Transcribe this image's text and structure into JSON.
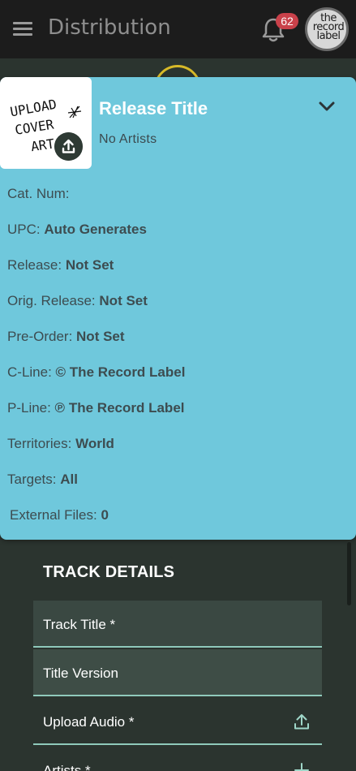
{
  "appbar": {
    "title": "Distribution",
    "notification_count": "62",
    "avatar_text": [
      "the",
      "record",
      "label"
    ]
  },
  "release": {
    "cover_text": [
      "UPLOAD",
      "COVER",
      "ART"
    ],
    "title": "Release Title",
    "artists": "No Artists",
    "details": [
      {
        "label": "Cat. Num:",
        "value": ""
      },
      {
        "label": "UPC:",
        "value": "Auto Generates"
      },
      {
        "label": "Release:",
        "value": "Not Set"
      },
      {
        "label": "Orig. Release:",
        "value": "Not Set"
      },
      {
        "label": "Pre-Order:",
        "value": "Not Set"
      },
      {
        "label": "C-Line:",
        "value": "© The Record Label"
      },
      {
        "label": "P-Line:",
        "value": "℗ The Record Label"
      },
      {
        "label": "Territories:",
        "value": "World"
      },
      {
        "label": "Targets:",
        "value": "All"
      },
      {
        "label": "External Files:",
        "value": "0"
      }
    ]
  },
  "track": {
    "heading": "TRACK DETAILS",
    "fields": [
      {
        "label": "Track Title *",
        "icon": ""
      },
      {
        "label": "Title Version",
        "icon": ""
      },
      {
        "label": "Upload Audio *",
        "icon": "upload-icon"
      },
      {
        "label": "Artists *",
        "icon": "plus-icon"
      }
    ]
  },
  "colors": {
    "card": "#6fc8dc",
    "appbar": "#1c1c1c",
    "background": "#2b342f",
    "badge": "#c9414a",
    "field_underline": "#8fc9bb"
  }
}
